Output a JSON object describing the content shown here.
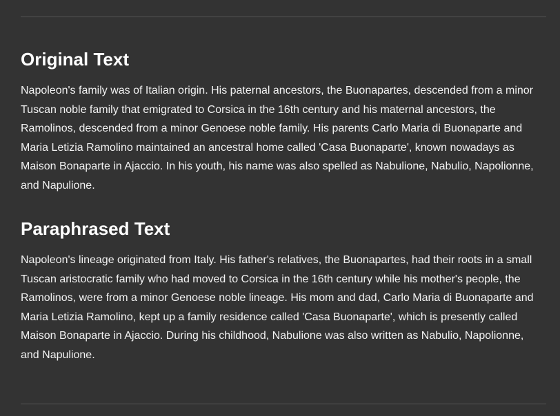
{
  "sections": [
    {
      "heading": "Original Text",
      "body": "Napoleon's family was of Italian origin. His paternal ancestors, the Buonapartes, descended from a minor Tuscan noble family that emigrated to Corsica in the 16th century and his maternal ancestors, the Ramolinos, descended from a minor Genoese noble family. His parents Carlo Maria di Buonaparte and Maria Letizia Ramolino maintained an ancestral home called 'Casa Buonaparte', known nowadays as Maison Bonaparte in Ajaccio. In his youth, his name was also spelled as Nabulione, Nabulio, Napolionne, and Napulione."
    },
    {
      "heading": "Paraphrased Text",
      "body": "Napoleon's lineage originated from Italy. His father's relatives, the Buonapartes, had their roots in a small Tuscan aristocratic family who had moved to Corsica in the 16th century while his mother's people, the Ramolinos, were from a minor Genoese noble lineage. His mom and dad, Carlo Maria di Buonaparte and Maria Letizia Ramolino, kept up a family residence called 'Casa Buonaparte', which is presently called Maison Bonaparte in Ajaccio. During his childhood, Nabulione was also written as Nabulio, Napolionne, and Napulione."
    }
  ],
  "colors": {
    "background": "#333333",
    "text": "#ffffff",
    "divider": "#555555"
  }
}
